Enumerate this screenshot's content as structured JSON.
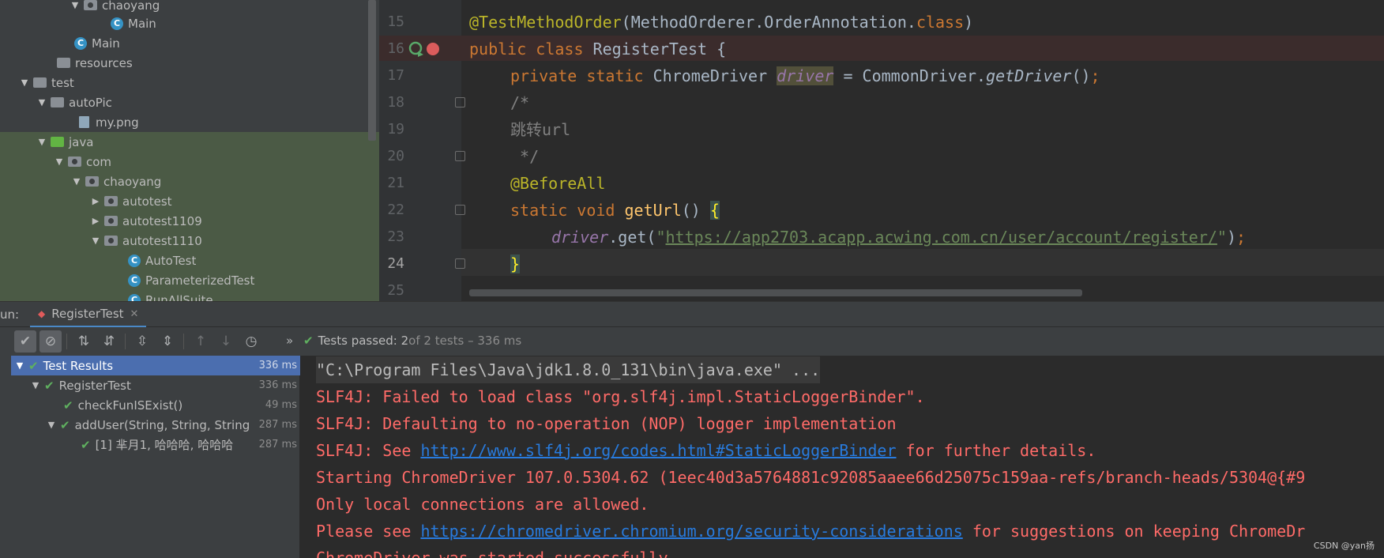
{
  "project_tree": {
    "items": [
      {
        "label": "chaoyang",
        "kind": "package",
        "expanded": true
      },
      {
        "label": "Main",
        "kind": "class"
      },
      {
        "label": "Main",
        "kind": "class"
      },
      {
        "label": "resources",
        "kind": "folder"
      },
      {
        "label": "test",
        "kind": "folder",
        "expanded": true
      },
      {
        "label": "autoPic",
        "kind": "folder",
        "expanded": true
      },
      {
        "label": "my.png",
        "kind": "image"
      },
      {
        "label": "java",
        "kind": "source-folder",
        "expanded": true
      },
      {
        "label": "com",
        "kind": "package",
        "expanded": true
      },
      {
        "label": "chaoyang",
        "kind": "package",
        "expanded": true
      },
      {
        "label": "autotest",
        "kind": "package",
        "expanded": false
      },
      {
        "label": "autotest1109",
        "kind": "package",
        "expanded": false
      },
      {
        "label": "autotest1110",
        "kind": "package",
        "expanded": true
      },
      {
        "label": "AutoTest",
        "kind": "class"
      },
      {
        "label": "ParameterizedTest",
        "kind": "class"
      },
      {
        "label": "RunAllSuite",
        "kind": "class"
      }
    ]
  },
  "editor": {
    "line_numbers": [
      "15",
      "16",
      "17",
      "18",
      "19",
      "20",
      "21",
      "22",
      "23",
      "24",
      "25"
    ],
    "lines": {
      "l15_ann": "@TestMethodOrder",
      "l15_rest": "(MethodOrderer.OrderAnnotation.",
      "l15_kw": "class",
      "l15_end": ")",
      "l16_kw": "public class ",
      "l16_rest": "RegisterTest {",
      "l17_kw": "private static ",
      "l17_type": "ChromeDriver ",
      "l17_field": "driver",
      "l17_eq": " = CommonDriver.",
      "l17_method": "getDriver",
      "l17_end": "()",
      "l17_semi": ";",
      "l18": "/*",
      "l19": "跳转url",
      "l20": " */",
      "l21": "@BeforeAll",
      "l22_kw": "static void ",
      "l22_method": "getUrl",
      "l22_paren": "() ",
      "l22_brace": "{",
      "l23_field": "driver",
      "l23_call": ".get(",
      "l23_q1": "\"",
      "l23_url": "https://app2703.acapp.acwing.com.cn/user/account/register/",
      "l23_q2": "\"",
      "l23_end": ")",
      "l23_semi": ";",
      "l24_brace": "}"
    }
  },
  "run_panel": {
    "label": "un:",
    "tab_label": "RegisterTest",
    "status_passed": "Tests passed: 2",
    "status_rest": " of 2 tests – 336 ms",
    "results": [
      {
        "label": "Test Results",
        "time": "336 ms"
      },
      {
        "label": "RegisterTest",
        "time": "336 ms"
      },
      {
        "label": "checkFunISExist()",
        "time": "49 ms"
      },
      {
        "label": "addUser(String, String, String",
        "time": "287 ms"
      },
      {
        "label": "[1] 芈月1, 哈哈哈, 哈哈哈",
        "time": "287 ms"
      }
    ]
  },
  "console": {
    "cmd": "\"C:\\Program Files\\Java\\jdk1.8.0_131\\bin\\java.exe\" ...",
    "l2": "SLF4J: Failed to load class \"org.slf4j.impl.StaticLoggerBinder\".",
    "l3": "SLF4J: Defaulting to no-operation (NOP) logger implementation",
    "l4_pre": "SLF4J: See ",
    "l4_link": "http://www.slf4j.org/codes.html#StaticLoggerBinder",
    "l4_post": " for further details.",
    "l5": "Starting ChromeDriver 107.0.5304.62 (1eec40d3a5764881c92085aaee66d25075c159aa-refs/branch-heads/5304@{#9",
    "l6": "Only local connections are allowed.",
    "l7_pre": "Please see ",
    "l7_link": "https://chromedriver.chromium.org/security-considerations",
    "l7_post": " for suggestions on keeping ChromeDr",
    "l8": "ChromeDriver was started successfully."
  },
  "watermark": "CSDN @yan扬",
  "colors": {
    "accent": "#4b6eaf",
    "pass": "#5fb05f",
    "error_text": "#ff6b68",
    "link": "#287bde"
  }
}
